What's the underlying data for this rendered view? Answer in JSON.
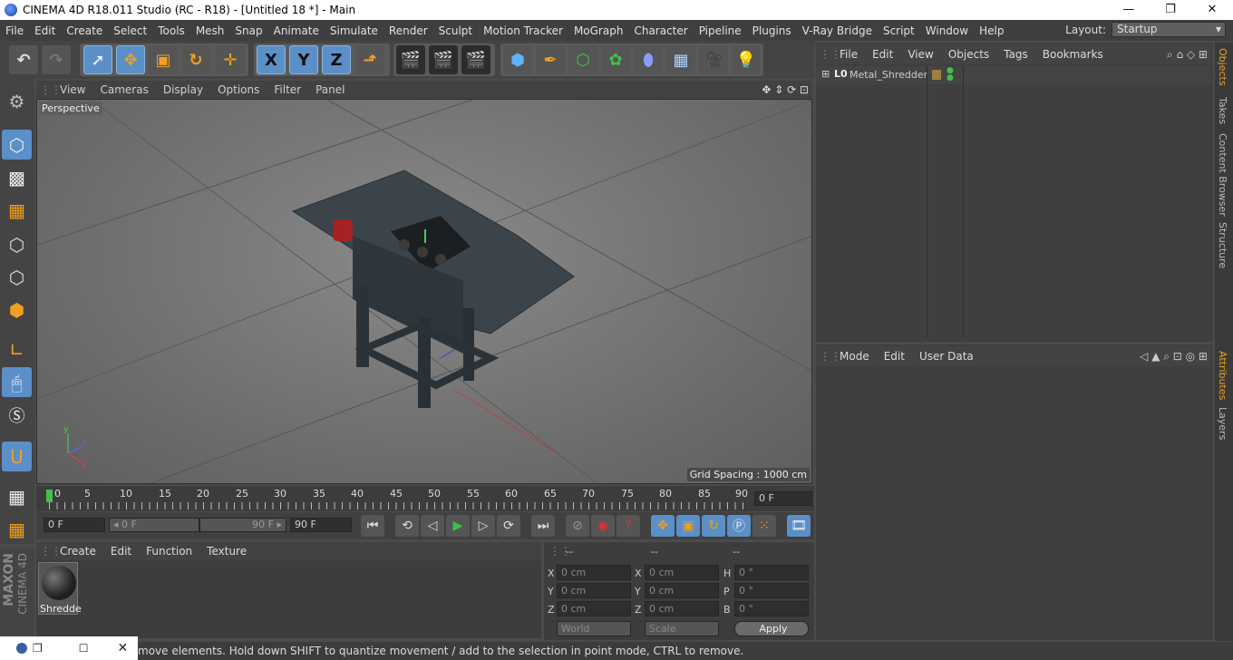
{
  "window": {
    "title": "CINEMA 4D R18.011 Studio (RC - R18) - [Untitled 18 *] - Main",
    "minimize": "—",
    "maximize": "❐",
    "close": "✕"
  },
  "menu": [
    "File",
    "Edit",
    "Create",
    "Select",
    "Tools",
    "Mesh",
    "Snap",
    "Animate",
    "Simulate",
    "Render",
    "Sculpt",
    "Motion Tracker",
    "MoGraph",
    "Character",
    "Pipeline",
    "Plugins",
    "V-Ray Bridge",
    "Script",
    "Window",
    "Help"
  ],
  "layout": {
    "label": "Layout:",
    "value": "Startup"
  },
  "toolbar": {
    "x": "X",
    "y": "Y",
    "z": "Z"
  },
  "viewport": {
    "menu": [
      "View",
      "Cameras",
      "Display",
      "Options",
      "Filter",
      "Panel"
    ],
    "label": "Perspective",
    "grid": "Grid Spacing : 1000 cm",
    "axis_x": "x",
    "axis_y": "y",
    "axis_z": "z"
  },
  "timeline": {
    "ticks": [
      "0",
      "5",
      "10",
      "15",
      "20",
      "25",
      "30",
      "35",
      "40",
      "45",
      "50",
      "55",
      "60",
      "65",
      "70",
      "75",
      "80",
      "85",
      "90"
    ],
    "current": "0 F"
  },
  "anim": {
    "start": "0 F",
    "range_start": "◂ 0 F",
    "range_end": "90 F ▸",
    "end": "90 F"
  },
  "material": {
    "menu": [
      "Create",
      "Edit",
      "Function",
      "Texture"
    ],
    "name": "Shredde"
  },
  "coords": {
    "headers": [
      "--",
      "--",
      "--"
    ],
    "rows": [
      {
        "l1": "X",
        "v1": "0 cm",
        "l2": "X",
        "v2": "0 cm",
        "l3": "H",
        "v3": "0 °"
      },
      {
        "l1": "Y",
        "v1": "0 cm",
        "l2": "Y",
        "v2": "0 cm",
        "l3": "P",
        "v3": "0 °"
      },
      {
        "l1": "Z",
        "v1": "0 cm",
        "l2": "Z",
        "v2": "0 cm",
        "l3": "B",
        "v3": "0 °"
      }
    ],
    "world": "World",
    "scale": "Scale",
    "apply": "Apply"
  },
  "objects": {
    "menu": [
      "File",
      "Edit",
      "View",
      "Objects",
      "Tags",
      "Bookmarks"
    ],
    "item": "Metal_Shredder",
    "layer_icon": "L0"
  },
  "attributes": {
    "menu": [
      "Mode",
      "Edit",
      "User Data"
    ]
  },
  "sidetabs": [
    "Objects",
    "Takes",
    "Content Browser",
    "Structure",
    "Attributes",
    "Layers"
  ],
  "brand": {
    "maxon": "MAXON",
    "c4d": "CINEMA 4D"
  },
  "status": "move elements. Hold down SHIFT to quantize movement / add to the selection in point mode, CTRL to remove.",
  "colors": {
    "accent": "#5b8fc8",
    "orange": "#f0a020",
    "play": "#3ec24a",
    "record": "#e03030"
  }
}
